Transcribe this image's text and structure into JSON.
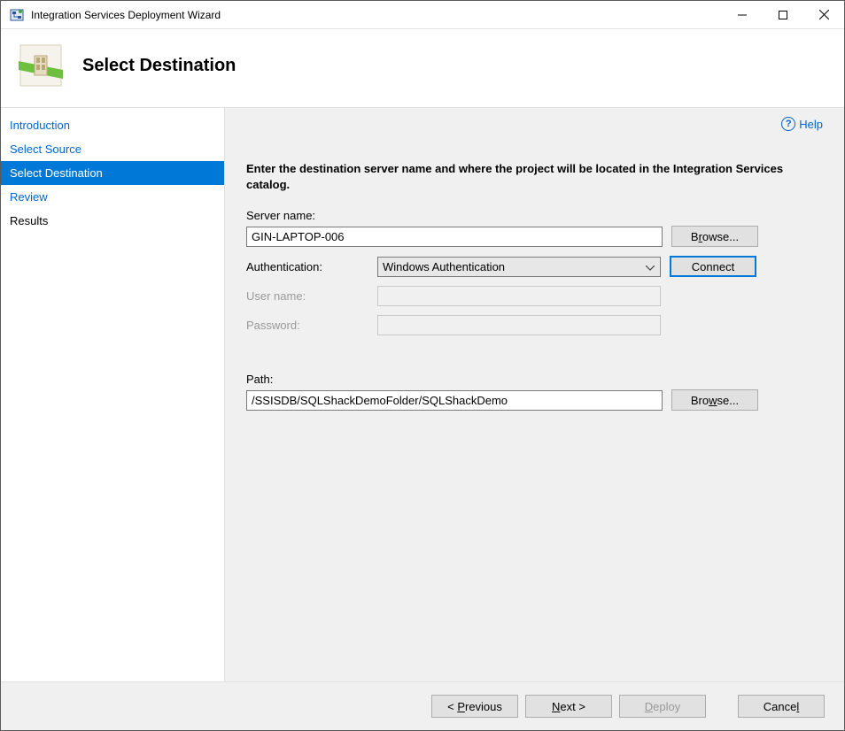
{
  "window": {
    "title": "Integration Services Deployment Wizard"
  },
  "header": {
    "page_title": "Select Destination"
  },
  "sidebar": {
    "items": [
      {
        "label": "Introduction",
        "state": "link"
      },
      {
        "label": "Select Source",
        "state": "link"
      },
      {
        "label": "Select Destination",
        "state": "selected"
      },
      {
        "label": "Review",
        "state": "link"
      },
      {
        "label": "Results",
        "state": "plain"
      }
    ]
  },
  "main": {
    "help_label": "Help",
    "instruction": "Enter the destination server name and where the project will be located in the Integration Services catalog.",
    "server_name_label": "Server name:",
    "server_name_value": "GIN-LAPTOP-006",
    "browse_server_label": "Browse...",
    "auth_label": "Authentication:",
    "auth_value": "Windows Authentication",
    "connect_label": "Connect",
    "user_name_label": "User name:",
    "user_name_value": "",
    "password_label": "Password:",
    "password_value": "",
    "path_label": "Path:",
    "path_value": "/SSISDB/SQLShackDemoFolder/SQLShackDemo",
    "browse_path_label": "Browse..."
  },
  "footer": {
    "previous_label": "< Previous",
    "next_label": "Next >",
    "deploy_label": "Deploy",
    "cancel_label": "Cancel"
  }
}
